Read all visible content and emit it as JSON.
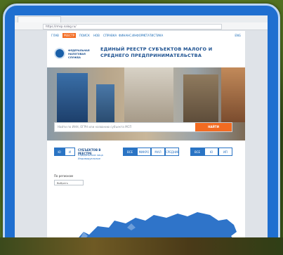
{
  "colors": {
    "frame_blue": "#1f6fd0",
    "frame_border": "#bcd6f5",
    "nav_blue": "#1f6fb8",
    "accent_orange": "#f36b21",
    "button_blue": "#2a74c4",
    "map_blue": "#2f74c9"
  },
  "browser": {
    "url": "https://rmsp.nalog.ru/"
  },
  "nav": {
    "items": [
      "ГЛАВ",
      "РЕЕСТР",
      "ПОИСК",
      "НОВ",
      "СПРАВКА",
      "ФИНАНС.ИНФОРМ",
      "СТАТИСТИКА"
    ],
    "active_index": 1,
    "lang": "ENG"
  },
  "header": {
    "logo_text": "ФЕДЕРАЛЬНАЯ НАЛОГОВАЯ СЛУЖБА",
    "title": "ЕДИНЫЙ РЕЕСТР СУБЪЕКТОВ МАЛОГО И СРЕДНЕГО ПРЕДПРИНИМАТЕЛЬСТВА"
  },
  "search": {
    "placeholder": "Найти по ИНН, ОГРН или названию субъекта МСП",
    "button": "НАЙТИ"
  },
  "filters": {
    "group1": [
      "Ю",
      "И"
    ],
    "group1_active": 0,
    "label": "СУБЪЕКТОВ В РЕЕСТРЕ",
    "sub1": "Юридические лица",
    "sub2": "Индивидуальные",
    "group2": [
      "ВСЕ",
      "МИКРО",
      "МАЛ",
      "СРЕДНИЕ"
    ],
    "group2_active": 0,
    "group3": [
      "ВСЕ",
      "Ю",
      "ИП"
    ],
    "group3_active": 0
  },
  "region": {
    "label": "По регионам",
    "select": "Выбрать"
  }
}
